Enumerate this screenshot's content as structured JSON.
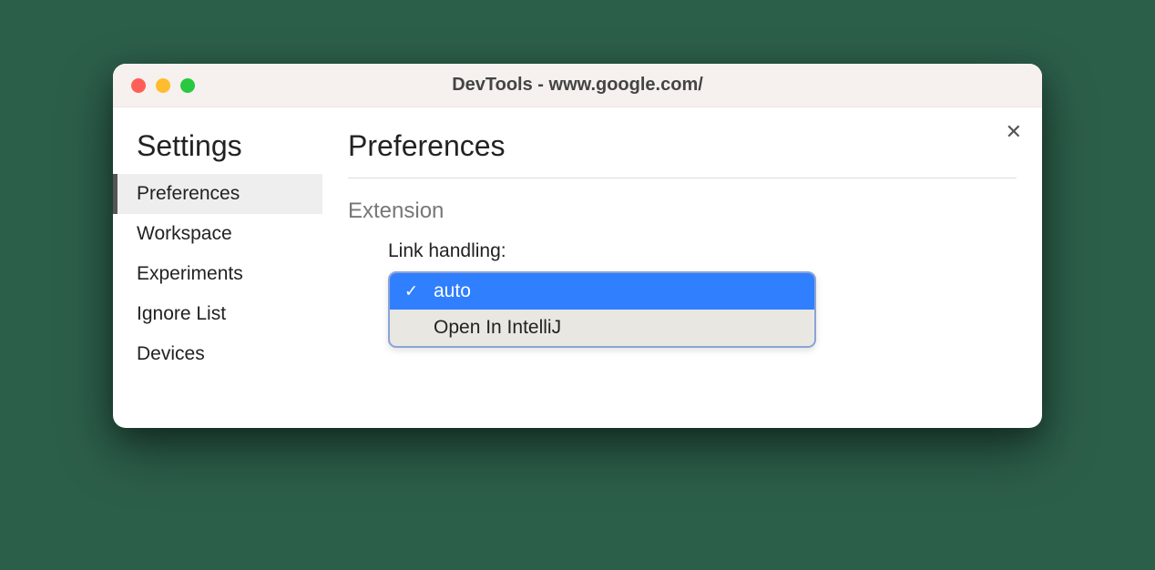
{
  "window": {
    "title": "DevTools - www.google.com/"
  },
  "sidebar": {
    "title": "Settings",
    "items": [
      {
        "label": "Preferences",
        "active": true
      },
      {
        "label": "Workspace",
        "active": false
      },
      {
        "label": "Experiments",
        "active": false
      },
      {
        "label": "Ignore List",
        "active": false
      },
      {
        "label": "Devices",
        "active": false
      }
    ]
  },
  "panel": {
    "title": "Preferences",
    "section": "Extension",
    "field_label": "Link handling:",
    "dropdown": {
      "options": [
        {
          "label": "auto",
          "selected": true
        },
        {
          "label": "Open In IntelliJ",
          "selected": false
        }
      ]
    }
  },
  "close_label": "✕"
}
